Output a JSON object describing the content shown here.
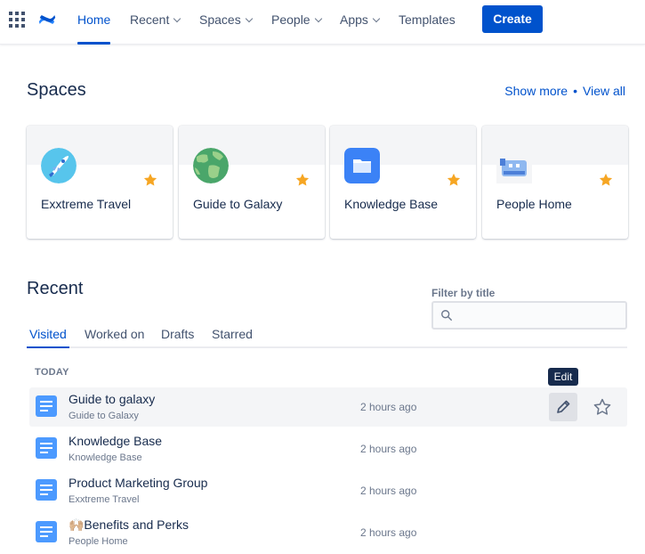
{
  "nav": {
    "items": [
      {
        "label": "Home",
        "active": true,
        "dropdown": false
      },
      {
        "label": "Recent",
        "dropdown": true
      },
      {
        "label": "Spaces",
        "dropdown": true
      },
      {
        "label": "People",
        "dropdown": true
      },
      {
        "label": "Apps",
        "dropdown": true
      },
      {
        "label": "Templates",
        "dropdown": false
      }
    ],
    "create_label": "Create"
  },
  "spaces": {
    "title": "Spaces",
    "show_more": "Show more",
    "separator": "•",
    "view_all": "View all",
    "cards": [
      {
        "name": "Exxtreme Travel",
        "icon": "rocket-icon",
        "starred": true
      },
      {
        "name": "Guide to Galaxy",
        "icon": "globe-icon",
        "starred": true
      },
      {
        "name": "Knowledge Base",
        "icon": "folder-icon",
        "starred": true
      },
      {
        "name": "People Home",
        "icon": "people-icon",
        "starred": true
      }
    ]
  },
  "recent": {
    "title": "Recent",
    "filter": {
      "label": "Filter by title",
      "value": "",
      "placeholder": ""
    },
    "tabs": [
      {
        "label": "Visited",
        "active": true
      },
      {
        "label": "Worked on"
      },
      {
        "label": "Drafts"
      },
      {
        "label": "Starred"
      }
    ],
    "group": "TODAY",
    "rows": [
      {
        "title": "Guide to galaxy",
        "space": "Guide to Galaxy",
        "time": "2 hours ago",
        "hovered": true
      },
      {
        "title": "Knowledge Base",
        "space": "Knowledge Base",
        "time": "2 hours ago"
      },
      {
        "title": "Product Marketing Group",
        "space": "Exxtreme Travel",
        "time": "2 hours ago"
      },
      {
        "title": "🙌🏼Benefits and Perks",
        "space": "People Home",
        "time": "2 hours ago"
      }
    ],
    "edit_tooltip": "Edit"
  },
  "colors": {
    "accent": "#0052cc",
    "star": "#f6a623",
    "doc": "#4c9aff"
  }
}
